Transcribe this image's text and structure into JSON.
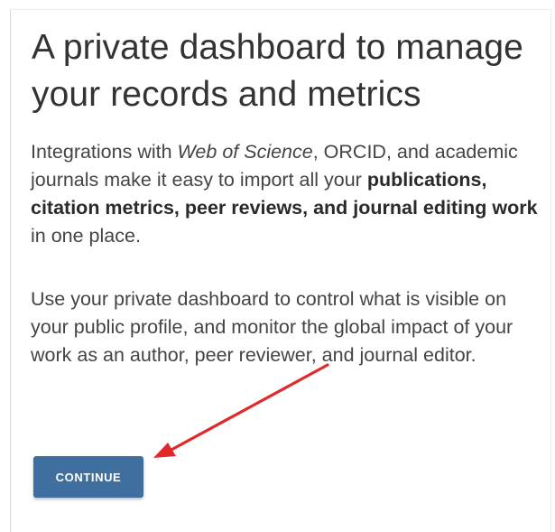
{
  "panel": {
    "title": "A private dashboard to manage your records and metrics",
    "paragraph1": {
      "text_a": "Integrations with ",
      "text_b_italic": "Web of Science",
      "text_c": ", ORCID, and academic journals make it easy to import all your ",
      "text_d_bold": "publications, citation metrics, peer reviews, and journal editing work",
      "text_e": " in one place."
    },
    "paragraph2": "Use your private dashboard to control what is visible on your public profile, and monitor the global impact of your work as an author, peer reviewer, and journal editor.",
    "continue_label": "CONTINUE"
  },
  "colors": {
    "button_bg": "#3f6f9f",
    "button_text": "#ffffff",
    "annotation_arrow": "#e0292b"
  },
  "icons": {
    "annotation": "red-arrow-icon"
  }
}
